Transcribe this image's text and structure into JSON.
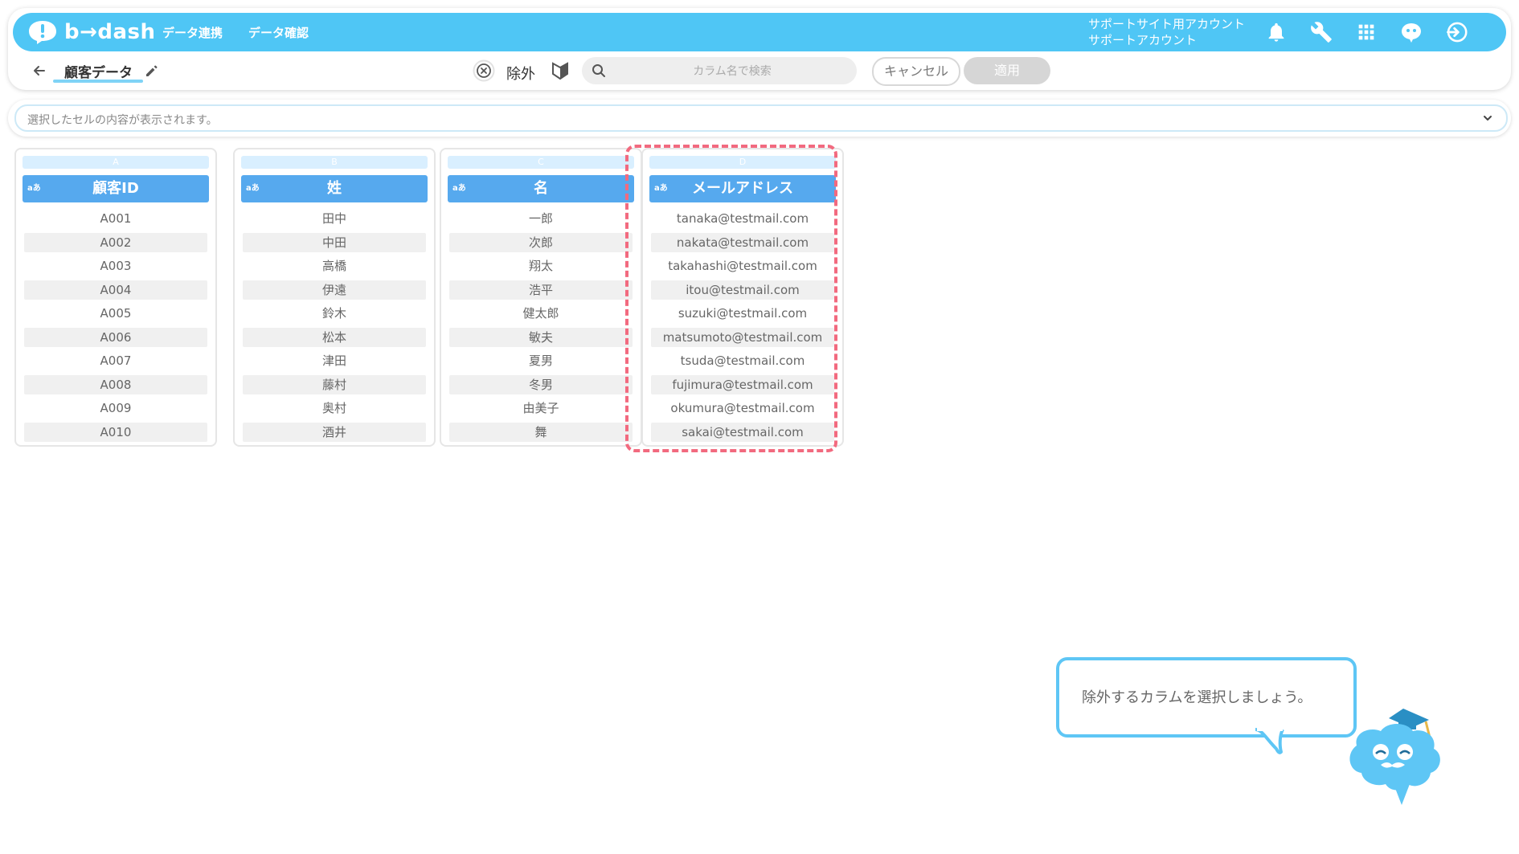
{
  "header": {
    "logo_text": "b→dash",
    "nav": [
      "データ連携",
      "データ確認"
    ],
    "account_line1": "サポートサイト用アカウント",
    "account_line2": "サポートアカウント",
    "color": "#4fc6f5"
  },
  "toolbar": {
    "tab_title": "顧客データ",
    "exclude_label": "除外",
    "search_placeholder": "カラム名で検索",
    "cancel_label": "キャンセル",
    "apply_label": "適用"
  },
  "preview": {
    "text": "選択したセルの内容が表示されます。"
  },
  "columns": [
    {
      "letter": "A",
      "type": "aあ",
      "header": "顧客ID",
      "values": [
        "A001",
        "A002",
        "A003",
        "A004",
        "A005",
        "A006",
        "A007",
        "A008",
        "A009",
        "A010"
      ]
    },
    {
      "letter": "B",
      "type": "aあ",
      "header": "姓",
      "values": [
        "田中",
        "中田",
        "高橋",
        "伊遠",
        "鈴木",
        "松本",
        "津田",
        "藤村",
        "奥村",
        "酒井"
      ]
    },
    {
      "letter": "C",
      "type": "aあ",
      "header": "名",
      "values": [
        "一郎",
        "次郎",
        "翔太",
        "浩平",
        "健太郎",
        "敏夫",
        "夏男",
        "冬男",
        "由美子",
        "舞"
      ]
    },
    {
      "letter": "D",
      "type": "aあ",
      "header": "メールアドレス",
      "values": [
        "tanaka@testmail.com",
        "nakata@testmail.com",
        "takahashi@testmail.com",
        "itou@testmail.com",
        "suzuki@testmail.com",
        "matsumoto@testmail.com",
        "tsuda@testmail.com",
        "fujimura@testmail.com",
        "okumura@testmail.com",
        "sakai@testmail.com"
      ]
    }
  ],
  "highlight_color": "#f26a7f",
  "tooltip": {
    "text": "除外するカラムを選択しましょう。"
  }
}
